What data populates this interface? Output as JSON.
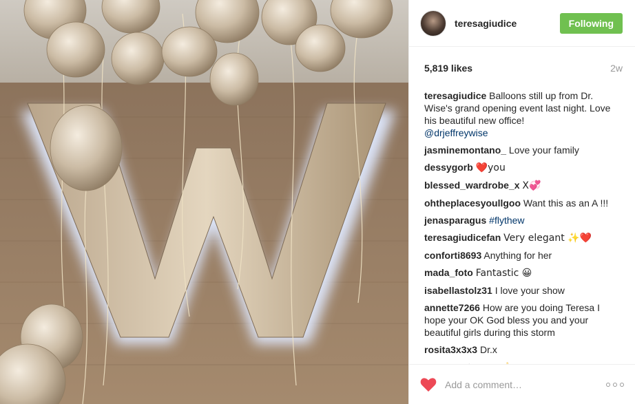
{
  "post": {
    "username": "teresagiudice",
    "follow_label": "Following",
    "likes": "5,819 likes",
    "time": "2w",
    "caption": {
      "user": "teresagiudice",
      "text": "Balloons still up from Dr. Wise's grand opening event last night. Love his beautiful new office!",
      "mention": "@drjeffreywise"
    },
    "comments": [
      {
        "user": "jasminemontano_",
        "text": "Love your family"
      },
      {
        "user": "dessygorb",
        "text": "❤️you"
      },
      {
        "user": "blessed_wardrobe_x",
        "text": "X💞"
      },
      {
        "user": "ohtheplacesyoullgoo",
        "text": "Want this as an A !!!"
      },
      {
        "user": "jenasparagus",
        "text": "",
        "link": "#flythew"
      },
      {
        "user": "teresagiudicefan",
        "text": "Very elegant ✨❤️"
      },
      {
        "user": "conforti8693",
        "text": "Anything for her"
      },
      {
        "user": "mada_foto",
        "text": "Fantastic 😀"
      },
      {
        "user": "isabellastolz31",
        "text": "I love your show"
      },
      {
        "user": "annette7266",
        "text": "How are you doing Teresa I hope your OK God bless you and your beautiful girls during this storm"
      },
      {
        "user": "rosita3x3x3",
        "text": "Dr.x"
      },
      {
        "user": "mosswestnessy",
        "text": "👍"
      }
    ],
    "add_comment_placeholder": "Add a comment…",
    "icons": {
      "like": "heart-icon",
      "more": "more-options-icon"
    },
    "colors": {
      "follow": "#70c050",
      "heart": "#ed4956",
      "link": "#003569"
    }
  }
}
